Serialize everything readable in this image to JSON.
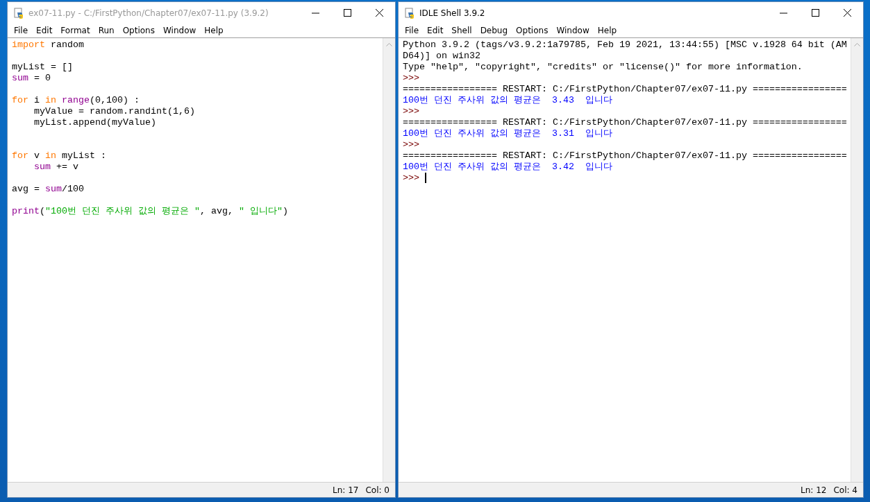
{
  "windows": [
    {
      "kind": "editor",
      "active": false,
      "title": "ex07-11.py - C:/FirstPython/Chapter07/ex07-11.py (3.9.2)",
      "menu": [
        "File",
        "Edit",
        "Format",
        "Run",
        "Options",
        "Window",
        "Help"
      ],
      "lines": [
        {
          "kind": "code",
          "tokens": [
            {
              "kind": "keyword",
              "text": "import"
            },
            {
              "kind": "plain",
              "text": " random"
            }
          ]
        },
        {
          "kind": "blank"
        },
        {
          "kind": "code",
          "tokens": [
            {
              "kind": "plain",
              "text": "myList = []"
            }
          ]
        },
        {
          "kind": "code",
          "tokens": [
            {
              "kind": "builtin",
              "text": "sum"
            },
            {
              "kind": "plain",
              "text": " = 0"
            }
          ]
        },
        {
          "kind": "blank"
        },
        {
          "kind": "code",
          "tokens": [
            {
              "kind": "keyword",
              "text": "for"
            },
            {
              "kind": "plain",
              "text": " i "
            },
            {
              "kind": "keyword",
              "text": "in "
            },
            {
              "kind": "builtin",
              "text": "range"
            },
            {
              "kind": "plain",
              "text": "(0,100) :"
            }
          ]
        },
        {
          "kind": "code",
          "tokens": [
            {
              "kind": "plain",
              "text": "    myValue = random.randint(1,6)"
            }
          ]
        },
        {
          "kind": "code",
          "tokens": [
            {
              "kind": "plain",
              "text": "    myList.append(myValue)"
            }
          ]
        },
        {
          "kind": "blank"
        },
        {
          "kind": "blank"
        },
        {
          "kind": "code",
          "tokens": [
            {
              "kind": "keyword",
              "text": "for"
            },
            {
              "kind": "plain",
              "text": " v "
            },
            {
              "kind": "keyword",
              "text": "in"
            },
            {
              "kind": "plain",
              "text": " myList :"
            }
          ]
        },
        {
          "kind": "code",
          "tokens": [
            {
              "kind": "builtin",
              "text": "    sum"
            },
            {
              "kind": "plain",
              "text": " += v"
            }
          ]
        },
        {
          "kind": "blank"
        },
        {
          "kind": "code",
          "tokens": [
            {
              "kind": "plain",
              "text": "avg = "
            },
            {
              "kind": "builtin",
              "text": "sum"
            },
            {
              "kind": "plain",
              "text": "/100"
            }
          ]
        },
        {
          "kind": "blank"
        },
        {
          "kind": "code",
          "tokens": [
            {
              "kind": "builtin",
              "text": "print"
            },
            {
              "kind": "plain",
              "text": "("
            },
            {
              "kind": "string",
              "text": "\"100번 던진 주사위 값의 평균은 \""
            },
            {
              "kind": "plain",
              "text": ", avg, "
            },
            {
              "kind": "string",
              "text": "\" 입니다\""
            },
            {
              "kind": "plain",
              "text": ")"
            }
          ]
        }
      ],
      "status": {
        "line": "Ln: 17",
        "col": "Col: 0"
      }
    },
    {
      "kind": "shell",
      "active": true,
      "title": "IDLE Shell 3.9.2",
      "menu": [
        "File",
        "Edit",
        "Shell",
        "Debug",
        "Options",
        "Window",
        "Help"
      ],
      "lines": [
        {
          "kind": "plain",
          "text": "Python 3.9.2 (tags/v3.9.2:1a79785, Feb 19 2021, 13:44:55) [MSC v.1928 64 bit (AM"
        },
        {
          "kind": "plain",
          "text": "D64)] on win32"
        },
        {
          "kind": "plain",
          "text": "Type \"help\", \"copyright\", \"credits\" or \"license()\" for more information."
        },
        {
          "kind": "prompt",
          "text": ">>>"
        },
        {
          "kind": "plain",
          "text": "================= RESTART: C:/FirstPython/Chapter07/ex07-11.py ================="
        },
        {
          "kind": "output",
          "text": "100번 던진 주사위 값의 평균은  3.43  입니다"
        },
        {
          "kind": "prompt",
          "text": ">>>"
        },
        {
          "kind": "plain",
          "text": "================= RESTART: C:/FirstPython/Chapter07/ex07-11.py ================="
        },
        {
          "kind": "output",
          "text": "100번 던진 주사위 값의 평균은  3.31  입니다"
        },
        {
          "kind": "prompt",
          "text": ">>>"
        },
        {
          "kind": "plain",
          "text": "================= RESTART: C:/FirstPython/Chapter07/ex07-11.py ================="
        },
        {
          "kind": "output",
          "text": "100번 던진 주사위 값의 평균은  3.42  입니다"
        },
        {
          "kind": "cursor",
          "text": ">>>"
        }
      ],
      "status": {
        "line": "Ln: 12",
        "col": "Col: 4"
      }
    }
  ]
}
